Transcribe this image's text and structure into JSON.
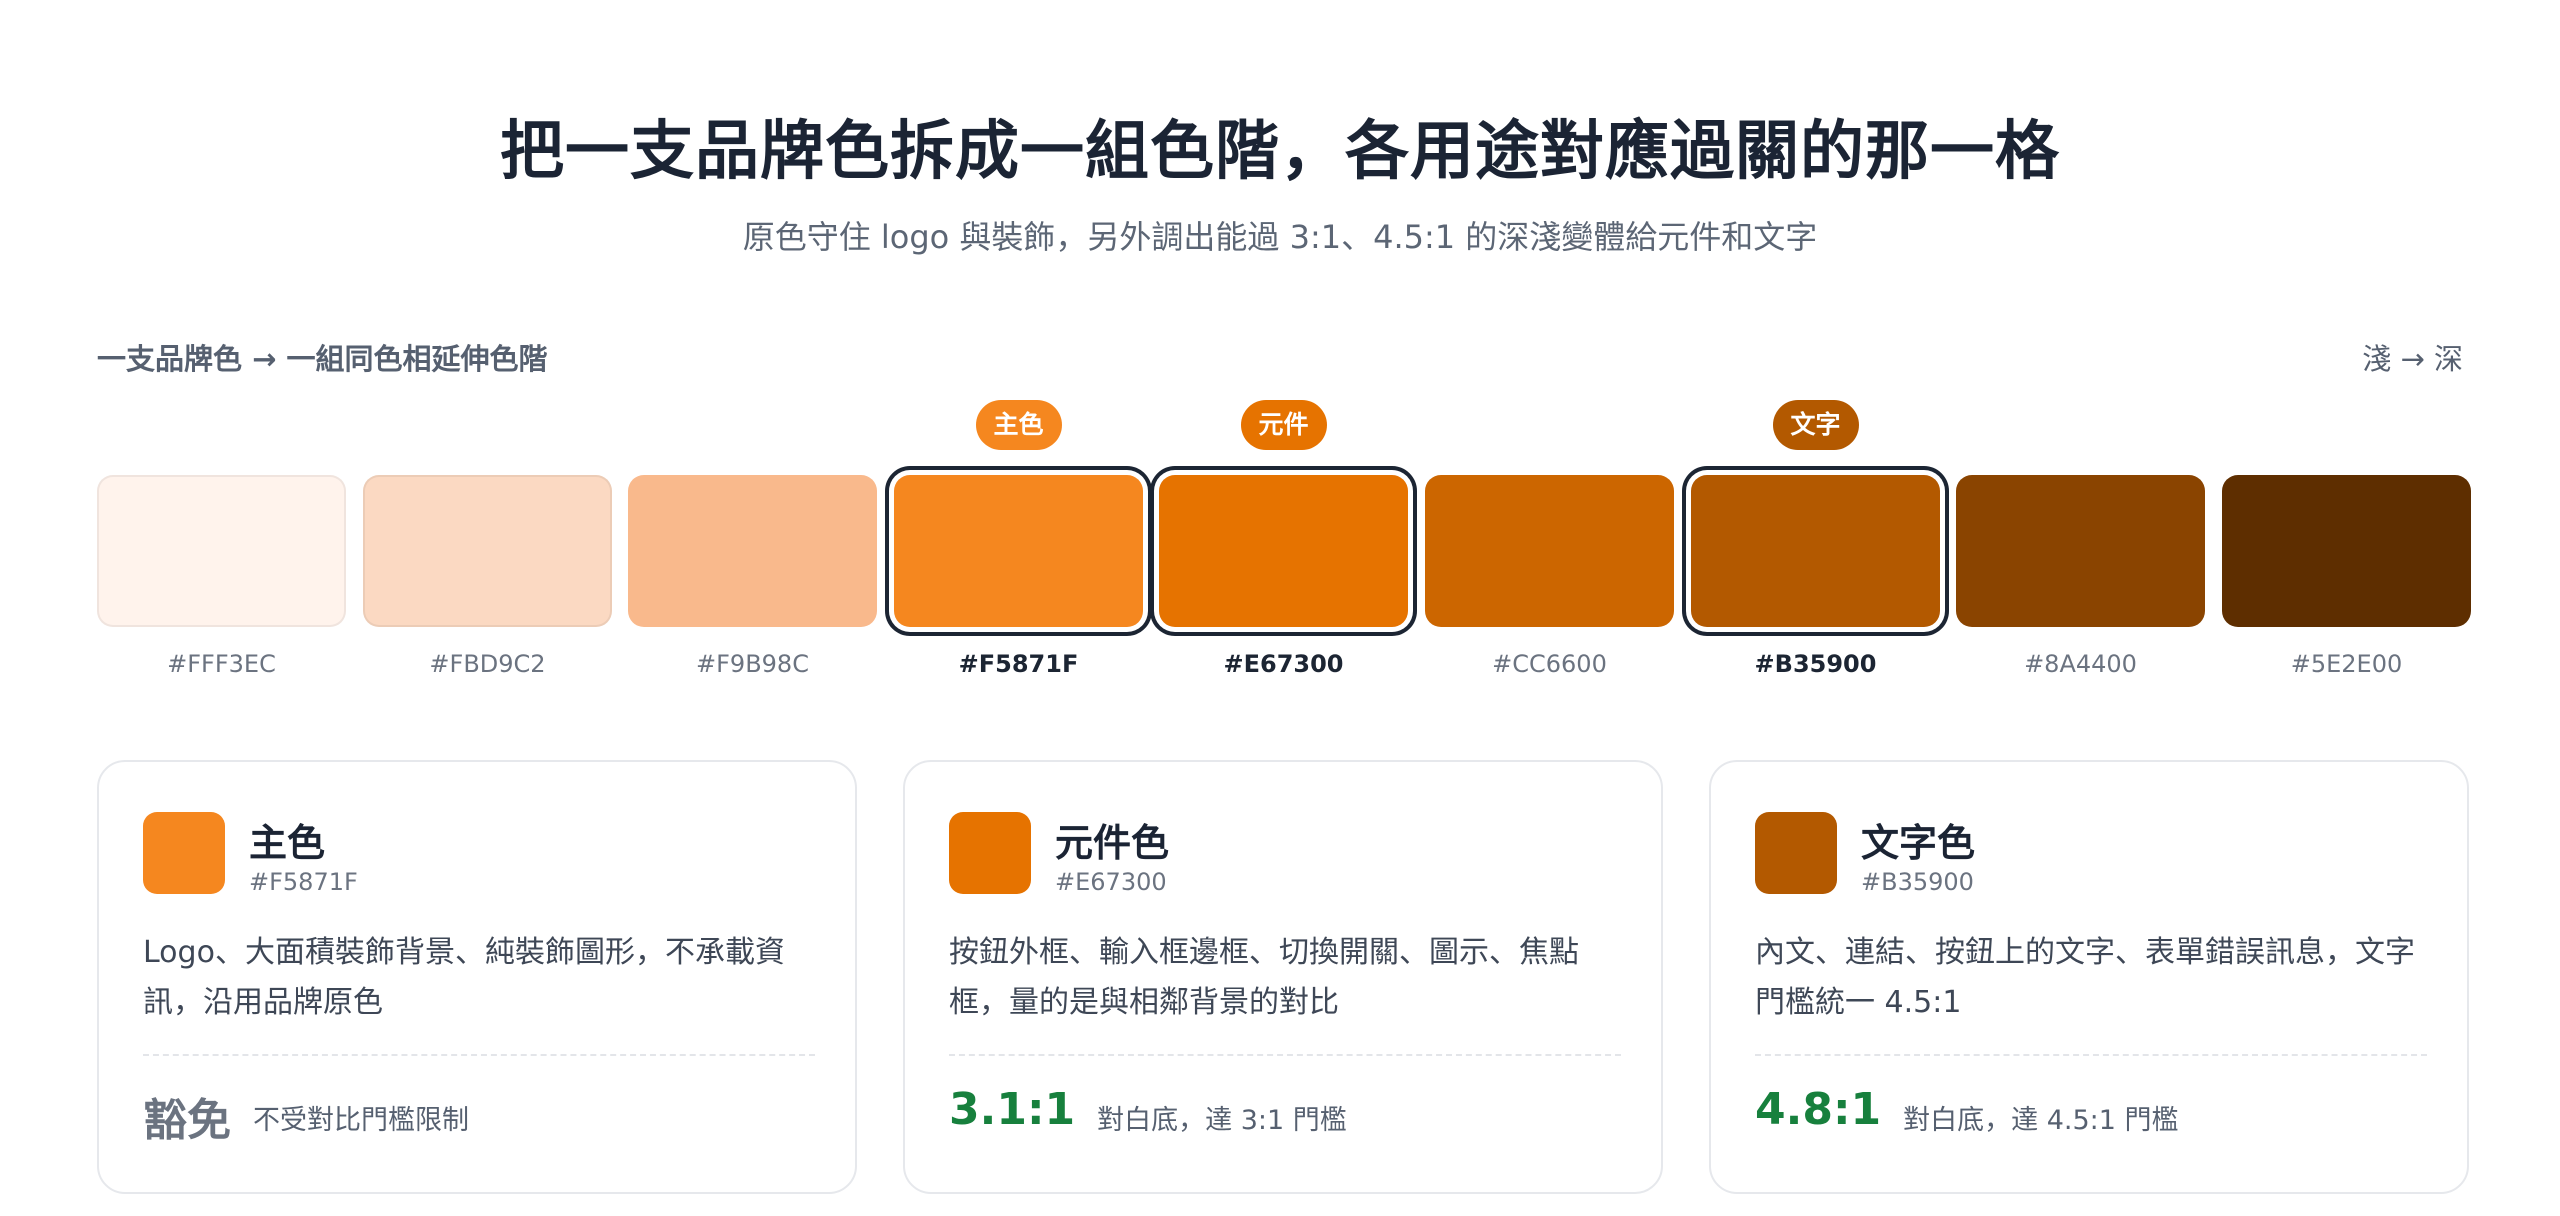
{
  "header": {
    "title": "把一支品牌色拆成一組色階，各用途對應過關的那一格",
    "subtitle": "原色守住 logo 與裝飾，另外調出能過 3:1、4.5:1 的深淺變體給元件和文字"
  },
  "scale": {
    "label_left": "一支品牌色 → 一組同色相延伸色階",
    "label_right": "淺 → 深",
    "swatches": [
      {
        "hex": "#FFF3EC",
        "color": "#FFF3EC",
        "badge": "",
        "badge_color": "",
        "selected": false,
        "light": true
      },
      {
        "hex": "#FBD9C2",
        "color": "#FBD9C2",
        "badge": "",
        "badge_color": "",
        "selected": false,
        "light": true
      },
      {
        "hex": "#F9B98C",
        "color": "#F9B98C",
        "badge": "",
        "badge_color": "",
        "selected": false,
        "light": false
      },
      {
        "hex": "#F5871F",
        "color": "#F5871F",
        "badge": "主色",
        "badge_color": "#F5871F",
        "selected": true,
        "light": false
      },
      {
        "hex": "#E67300",
        "color": "#E67300",
        "badge": "元件",
        "badge_color": "#E67300",
        "selected": true,
        "light": false
      },
      {
        "hex": "#CC6600",
        "color": "#CC6600",
        "badge": "",
        "badge_color": "",
        "selected": false,
        "light": false
      },
      {
        "hex": "#B35900",
        "color": "#B35900",
        "badge": "文字",
        "badge_color": "#B35900",
        "selected": true,
        "light": false
      },
      {
        "hex": "#8A4400",
        "color": "#8A4400",
        "badge": "",
        "badge_color": "",
        "selected": false,
        "light": false
      },
      {
        "hex": "#5E2E00",
        "color": "#5E2E00",
        "badge": "",
        "badge_color": "",
        "selected": false,
        "light": false
      }
    ]
  },
  "cards": [
    {
      "name": "主色",
      "hex": "#F5871F",
      "color": "#F5871F",
      "desc": "Logo、大面積裝飾背景、純裝飾圖形，不承載資訊，沿用品牌原色",
      "ratio": "豁免",
      "ratio_style": "muted",
      "note": "不受對比門檻限制"
    },
    {
      "name": "元件色",
      "hex": "#E67300",
      "color": "#E67300",
      "desc": "按鈕外框、輸入框邊框、切換開關、圖示、焦點框，量的是與相鄰背景的對比",
      "ratio": "3.1:1",
      "ratio_style": "pass",
      "note": "對白底，達 3:1 門檻"
    },
    {
      "name": "文字色",
      "hex": "#B35900",
      "color": "#B35900",
      "desc": "內文、連結、按鈕上的文字、表單錯誤訊息，文字門檻統一 4.5:1",
      "ratio": "4.8:1",
      "ratio_style": "pass",
      "note": "對白底，達 4.5:1 門檻"
    }
  ]
}
